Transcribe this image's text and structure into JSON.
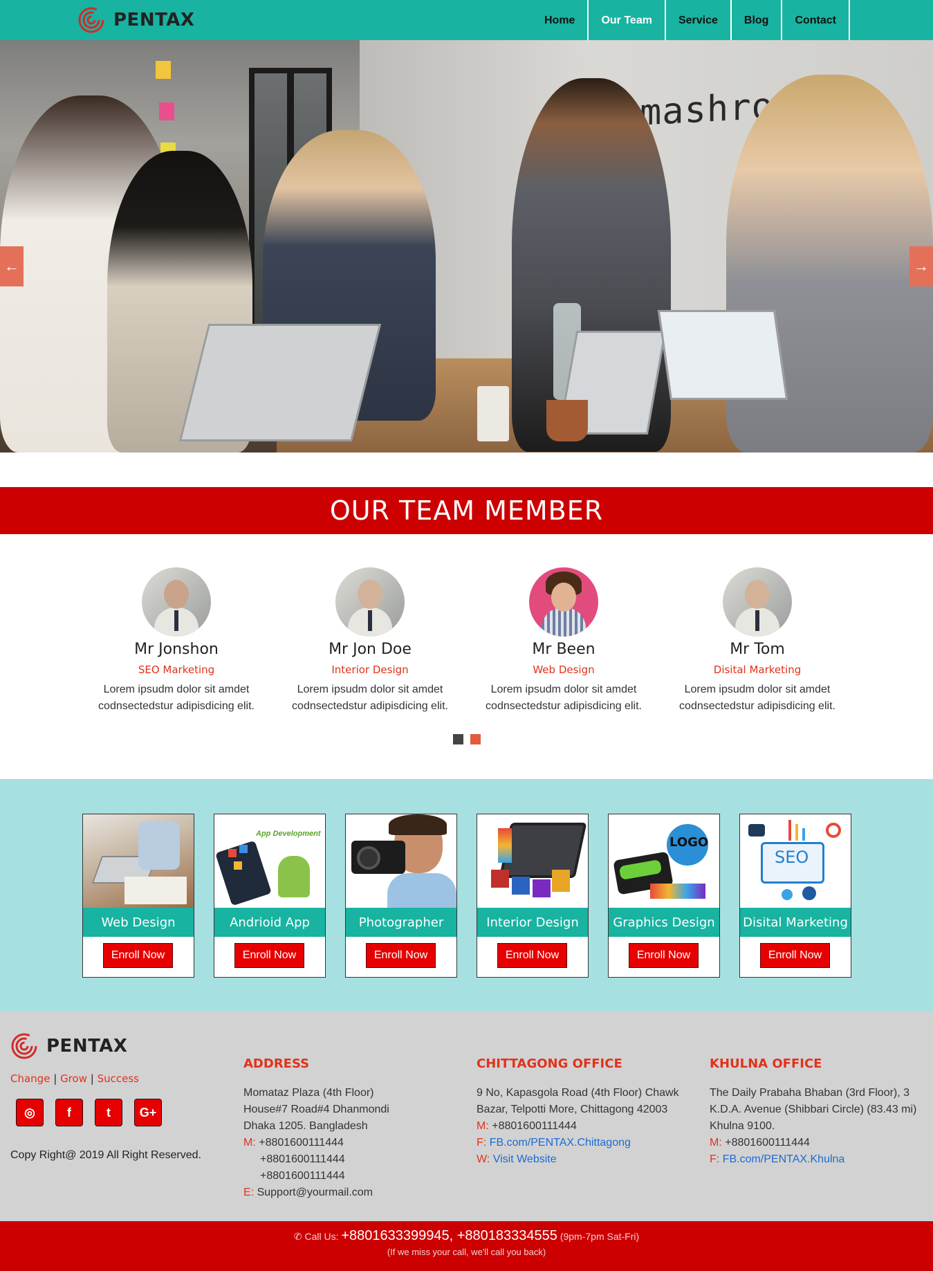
{
  "nav": {
    "brand": "PENTAX",
    "items": [
      {
        "label": "Home"
      },
      {
        "label": "Our Team"
      },
      {
        "label": "Service"
      },
      {
        "label": "Blog"
      },
      {
        "label": "Contact"
      }
    ],
    "active_index": 1
  },
  "hero": {
    "sign_text": "mashroom6",
    "slide_count": 6,
    "active_slide": 0,
    "prev_icon": "arrow-left-icon",
    "next_icon": "arrow-right-icon"
  },
  "team": {
    "heading": "OUR TEAM MEMBER",
    "members": [
      {
        "name": "Mr Jonshon",
        "role": "SEO Marketing",
        "desc": "Lorem ipsudm dolor sit amdet codnsectedstur adipisdicing elit."
      },
      {
        "name": "Mr Jon Doe",
        "role": "Interior Design",
        "desc": "Lorem ipsudm dolor sit amdet codnsectedstur adipisdicing elit."
      },
      {
        "name": "Mr Been",
        "role": "Web Design",
        "desc": "Lorem ipsudm dolor sit amdet codnsectedstur adipisdicing elit."
      },
      {
        "name": "Mr Tom",
        "role": "Disital Marketing",
        "desc": "Lorem ipsudm dolor sit amdet codnsectedstur adipisdicing elit."
      }
    ]
  },
  "services": {
    "cards": [
      {
        "title": "Web Design",
        "button": "Enroll Now"
      },
      {
        "title": "Andrioid App",
        "button": "Enroll Now",
        "img_text": "App Development"
      },
      {
        "title": "Photographer",
        "button": "Enroll Now"
      },
      {
        "title": "Interior Design",
        "button": "Enroll Now"
      },
      {
        "title": "Graphics Design",
        "button": "Enroll Now",
        "img_text": "LOGO"
      },
      {
        "title": "Disital Marketing",
        "button": "Enroll Now",
        "img_text": "SEO"
      }
    ]
  },
  "footer": {
    "brand": "PENTAX",
    "tagline": [
      "Change",
      "Grow",
      "Success"
    ],
    "social": [
      {
        "icon": "instagram-icon",
        "glyph": "◎"
      },
      {
        "icon": "facebook-icon",
        "glyph": "f"
      },
      {
        "icon": "twitter-icon",
        "glyph": "t"
      },
      {
        "icon": "google-plus-icon",
        "glyph": "G+"
      }
    ],
    "copyright": "Copy Right@ 2019 All Right Reserved.",
    "address": {
      "heading": "ADDRESS",
      "lines": [
        "Momataz Plaza (4th Floor)",
        "House#7 Road#4 Dhanmondi",
        "Dhaka 1205. Bangladesh"
      ],
      "m_label": "M:",
      "phones": [
        "+8801600111444",
        "+8801600111444",
        "+8801600111444"
      ],
      "e_label": "E:",
      "email": "Support@yourmail.com"
    },
    "chittagong": {
      "heading": "CHITTAGONG OFFICE",
      "lines": [
        "9 No, Kapasgola Road (4th Floor) Chawk",
        "Bazar, Telpotti More, Chittagong 42003"
      ],
      "m_label": "M:",
      "phone": "+8801600111444",
      "f_label": "F:",
      "fb": "FB.com/PENTAX.Chittagong",
      "w_label": "W:",
      "web": "Visit Website"
    },
    "khulna": {
      "heading": "KHULNA OFFICE",
      "lines": [
        "The Daily Prabaha Bhaban (3rd Floor), 3",
        "K.D.A. Avenue (Shibbari Circle) (83.43 mi)",
        "Khulna 9100."
      ],
      "m_label": "M:",
      "phone": "+8801600111444",
      "f_label": "F:",
      "fb": "FB.com/PENTAX.Khulna"
    }
  },
  "callbar": {
    "prefix": "Call Us:",
    "numbers": "+8801633399945, +880183334555",
    "hours": "(9pm-7pm Sat-Fri)",
    "note": "(If we miss your call, we'll call you back)"
  },
  "colors": {
    "teal": "#18b3a1",
    "red": "#cc0000",
    "accent_red": "#e1321b",
    "service_bg": "#a6e0e0",
    "footer_bg": "#d2d2d2"
  }
}
